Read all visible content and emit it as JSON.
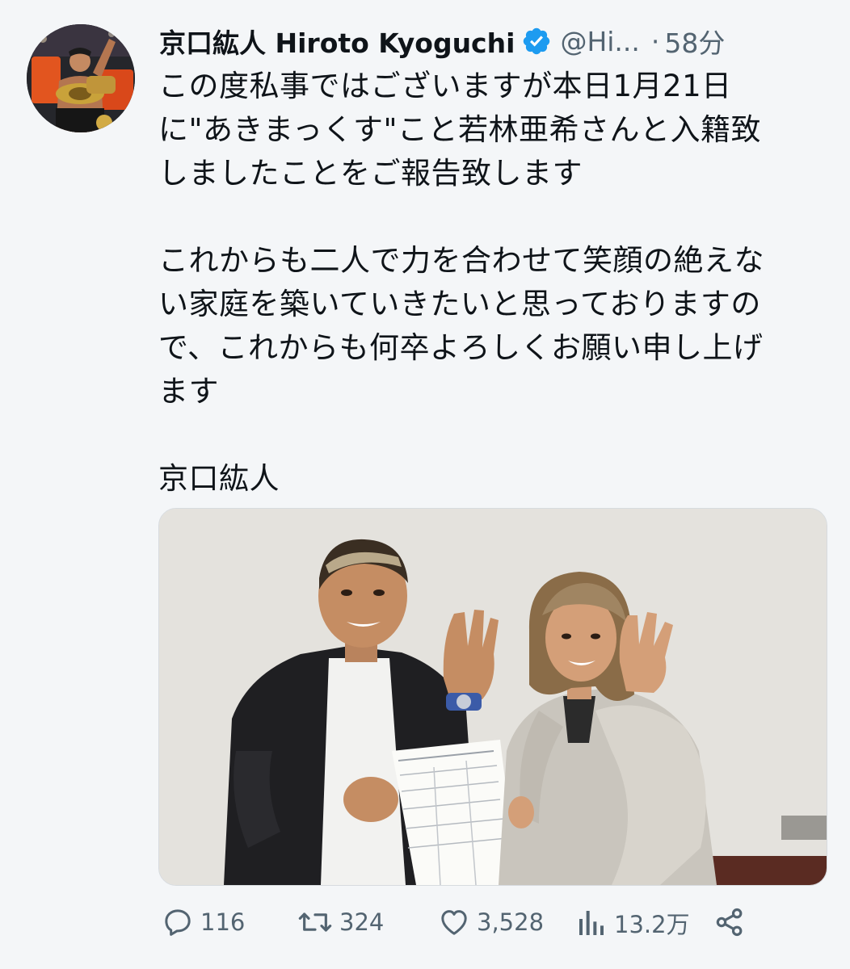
{
  "tweet": {
    "display_name": "京口紘人 Hiroto Kyoguchi",
    "handle": "@Hi...",
    "separator": "·",
    "time": "58分",
    "text": "この度私事ではございますが本日1月21日\nに\"あきまっくす\"こと若林亜希さんと入籍致\nしましたことをご報告致します\n\nこれからも二人で力を合わせて笑顔の絶えな\nい家庭を築いていきたいと思っておりますの\nで、これからも何卒よろしくお願い申し上げ\nます\n\n京口紘人"
  },
  "actions": {
    "reply_count": "116",
    "retweet_count": "324",
    "like_count": "3,528",
    "view_count": "13.2万"
  },
  "icons": {
    "verified": "verified-badge-icon",
    "reply": "reply-icon",
    "retweet": "retweet-icon",
    "like": "heart-icon",
    "views": "views-chart-icon",
    "share": "share-icon"
  },
  "colors": {
    "verified_blue": "#1d9bf0",
    "secondary_text": "#536471",
    "primary_text": "#0f1419"
  }
}
